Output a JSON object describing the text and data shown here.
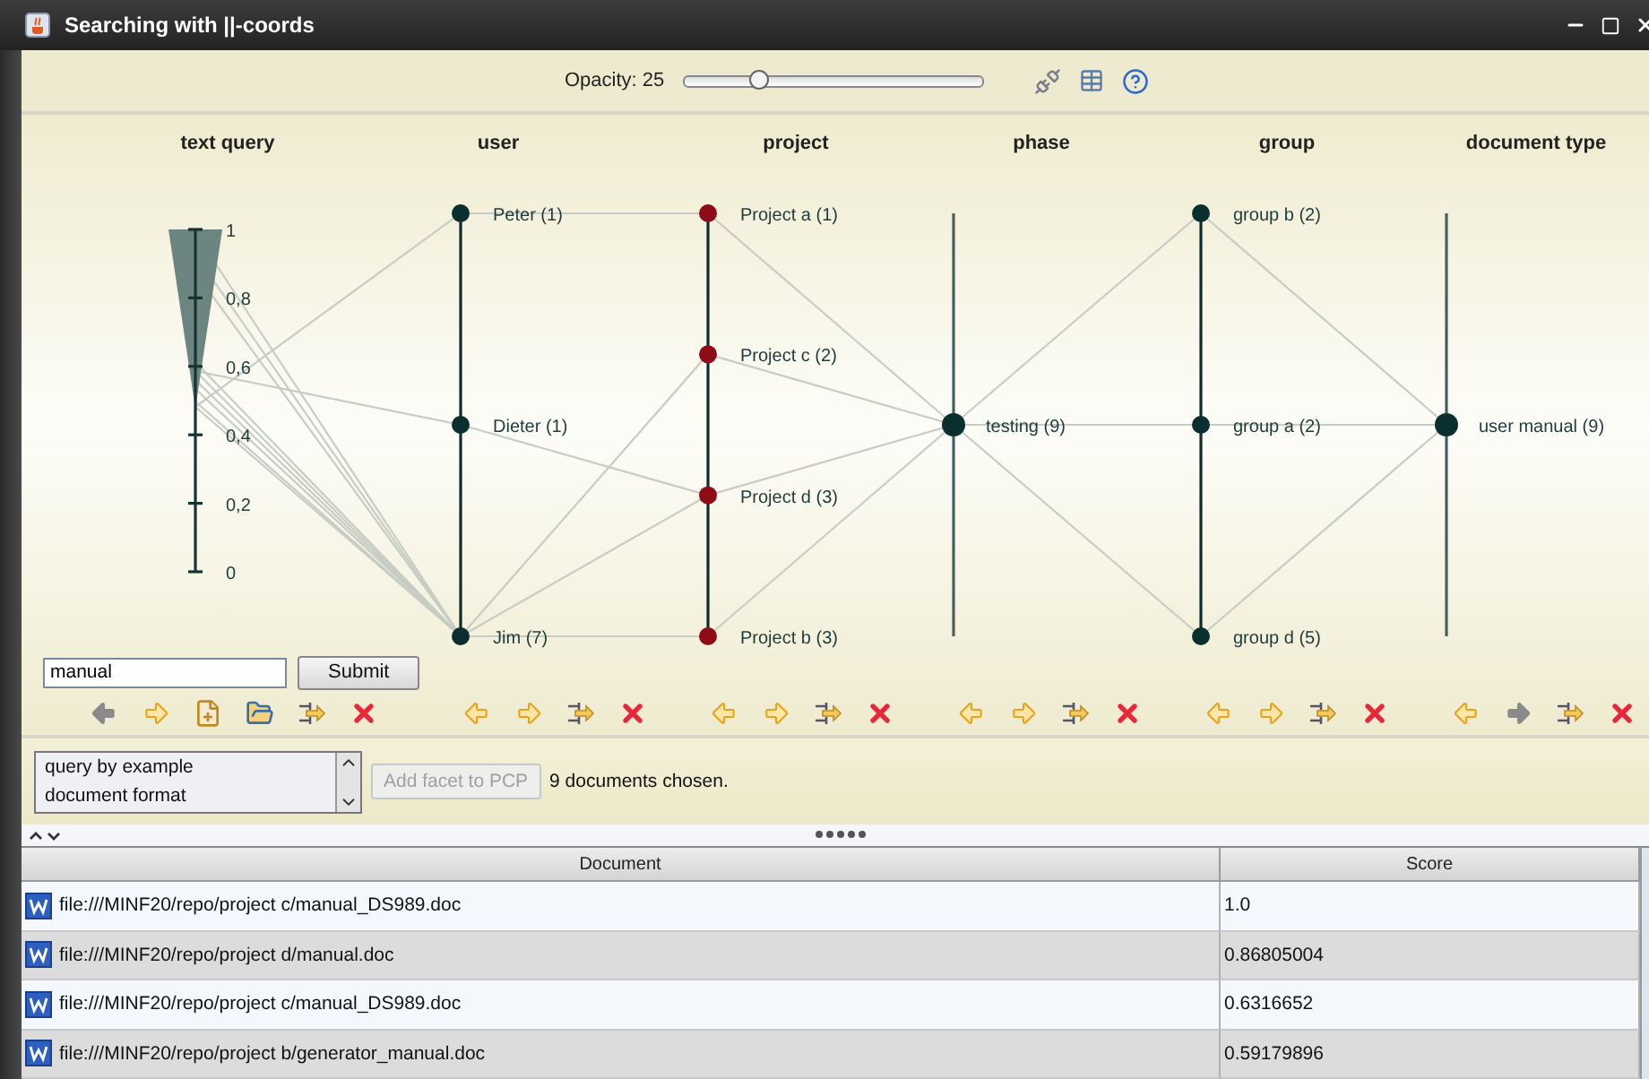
{
  "window": {
    "title": "Searching with ||-coords"
  },
  "toolbar": {
    "opacity_label": "Opacity: 25",
    "opacity": {
      "level": 0.25
    }
  },
  "axes": [
    {
      "title": "text query",
      "kind": "scale",
      "ticks": [
        "1",
        "0,8",
        "0,6",
        "0,4",
        "0,2",
        "0"
      ],
      "tools": [
        {
          "kind": "left",
          "disabled": true
        },
        {
          "kind": "right",
          "disabled": false
        },
        {
          "kind": "add-file"
        },
        {
          "kind": "image-folder"
        },
        {
          "kind": "align"
        },
        {
          "kind": "remove"
        }
      ]
    },
    {
      "title": "user",
      "kind": "nodes",
      "nodes": [
        {
          "label": "Peter (1)",
          "color": "#0b2e2e"
        },
        {
          "label": "Dieter (1)",
          "color": "#0b2e2e"
        },
        {
          "label": "Jim (7)",
          "color": "#0b2e2e"
        }
      ],
      "tools": [
        {
          "kind": "left",
          "disabled": false
        },
        {
          "kind": "right",
          "disabled": false
        },
        {
          "kind": "align"
        },
        {
          "kind": "remove"
        }
      ]
    },
    {
      "title": "project",
      "kind": "nodes",
      "nodes": [
        {
          "label": "Project a (1)",
          "color": "#8e0c16"
        },
        {
          "label": "Project c (2)",
          "color": "#8e0c16"
        },
        {
          "label": "Project d (3)",
          "color": "#8e0c16"
        },
        {
          "label": "Project b (3)",
          "color": "#8e0c16"
        }
      ],
      "tools": [
        {
          "kind": "left",
          "disabled": false
        },
        {
          "kind": "right",
          "disabled": false
        },
        {
          "kind": "align"
        },
        {
          "kind": "remove"
        }
      ]
    },
    {
      "title": "phase",
      "kind": "nodes",
      "nodes": [
        {
          "label": "testing (9)",
          "color": "#0b2e2e"
        }
      ],
      "tools": [
        {
          "kind": "left",
          "disabled": false
        },
        {
          "kind": "right",
          "disabled": false
        },
        {
          "kind": "align"
        },
        {
          "kind": "remove"
        }
      ]
    },
    {
      "title": "group",
      "kind": "nodes",
      "nodes": [
        {
          "label": "group b (2)",
          "color": "#0b2e2e"
        },
        {
          "label": "group a (2)",
          "color": "#0b2e2e"
        },
        {
          "label": "group d (5)",
          "color": "#0b2e2e"
        }
      ],
      "tools": [
        {
          "kind": "left",
          "disabled": false
        },
        {
          "kind": "right",
          "disabled": false
        },
        {
          "kind": "align"
        },
        {
          "kind": "remove"
        }
      ]
    },
    {
      "title": "document type",
      "kind": "nodes",
      "nodes": [
        {
          "label": "user manual (9)",
          "color": "#0b2e2e"
        }
      ],
      "tools": [
        {
          "kind": "left",
          "disabled": false
        },
        {
          "kind": "right",
          "disabled": true
        },
        {
          "kind": "align"
        },
        {
          "kind": "remove"
        }
      ]
    }
  ],
  "query": {
    "value": "manual",
    "submit": "Submit"
  },
  "facets": {
    "items": [
      "query by example",
      "document format"
    ],
    "add_button": {
      "label": "Add facet to PCP",
      "disabled": true
    },
    "status": "9 documents chosen."
  },
  "table": {
    "columns": [
      "Document",
      "Score"
    ],
    "rows": [
      {
        "document": "file:///MINF20/repo/project c/manual_DS989.doc",
        "score": "1.0"
      },
      {
        "document": "file:///MINF20/repo/project d/manual.doc",
        "score": "0.86805004"
      },
      {
        "document": "file:///MINF20/repo/project c/manual_DS989.doc",
        "score": "0.6316652"
      },
      {
        "document": "file:///MINF20/repo/project b/generator_manual.doc",
        "score": "0.59179896"
      }
    ]
  }
}
